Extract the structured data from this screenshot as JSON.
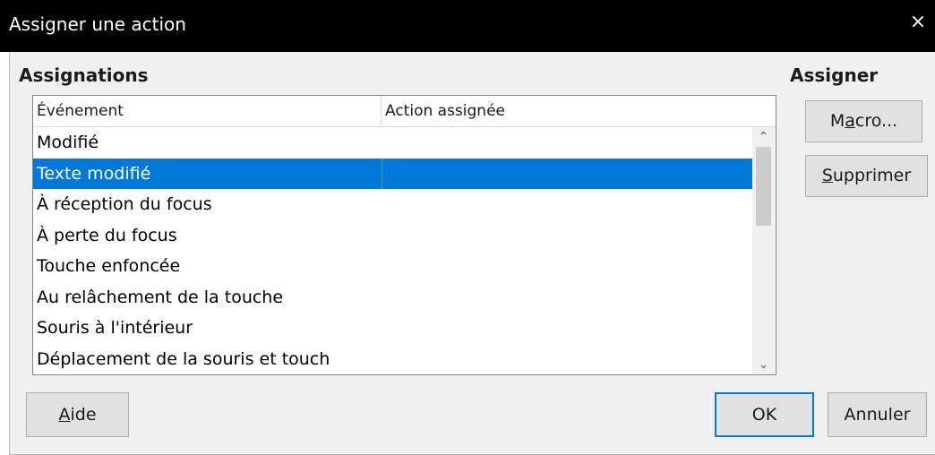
{
  "window": {
    "title": "Assigner une action",
    "close_glyph": "×"
  },
  "assignments": {
    "section_label": "Assignations",
    "columns": [
      "Événement",
      "Action assignée"
    ],
    "rows": [
      {
        "event": "Modifié",
        "action": ""
      },
      {
        "event": "Texte modifié",
        "action": "",
        "selected": true
      },
      {
        "event": "À réception du focus",
        "action": ""
      },
      {
        "event": "À perte du focus",
        "action": ""
      },
      {
        "event": "Touche enfoncée",
        "action": ""
      },
      {
        "event": "Au relâchement de la touche",
        "action": ""
      },
      {
        "event": "Souris à l'intérieur",
        "action": ""
      },
      {
        "event": "Déplacement de la souris et touch",
        "action": ""
      }
    ]
  },
  "assign": {
    "section_label": "Assigner",
    "macro_button": {
      "pre": "M",
      "mnemonic": "a",
      "post": "cro..."
    },
    "delete_button": {
      "pre": "",
      "mnemonic": "S",
      "post": "upprimer"
    }
  },
  "footer": {
    "help_button": {
      "pre": "",
      "mnemonic": "A",
      "post": "ide"
    },
    "ok_label": "OK",
    "cancel_label": "Annuler"
  },
  "colors": {
    "selection": "#0078d7",
    "titlebar": "#000000",
    "dialog_bg": "#f0f0f0"
  }
}
